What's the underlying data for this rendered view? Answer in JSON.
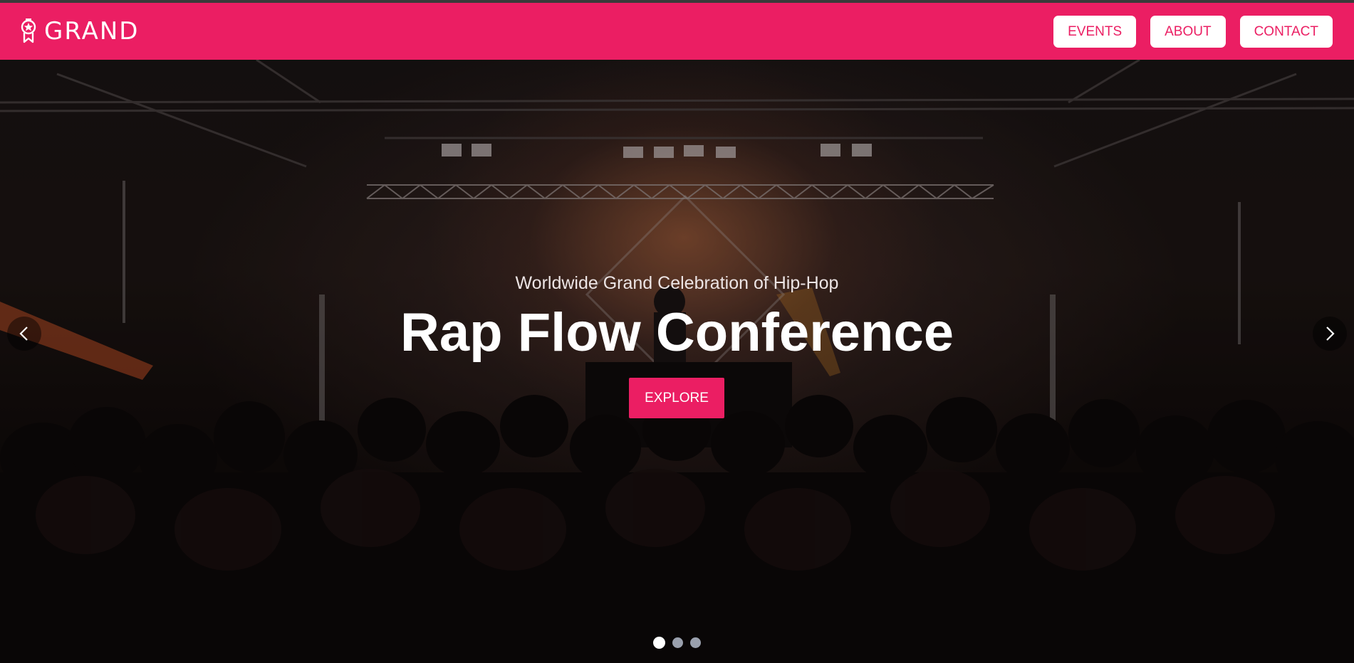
{
  "navbar": {
    "brand": "GRAND",
    "brand_icon": "award-icon",
    "links": [
      "EVENTS",
      "ABOUT",
      "CONTACT"
    ],
    "accent_color": "#eb1e63"
  },
  "hero": {
    "subtitle": "Worldwide Grand Celebration of Hip-Hop",
    "title": "Rap Flow Conference",
    "button_label": "EXPLORE",
    "prev_icon": "chevron-left-icon",
    "next_icon": "chevron-right-icon",
    "slide_count": 3,
    "active_slide": 1
  }
}
